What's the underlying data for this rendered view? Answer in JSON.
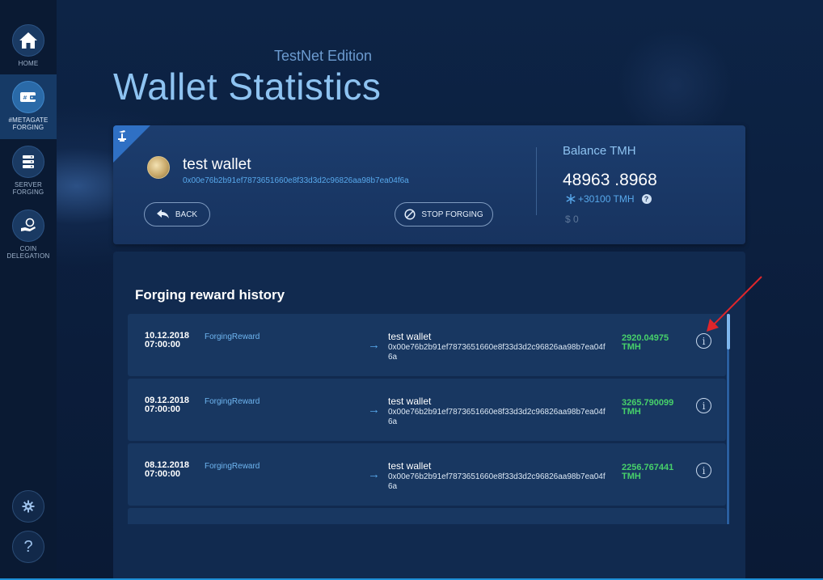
{
  "sidebar": {
    "items": [
      {
        "label": "HOME",
        "icon": "home-icon"
      },
      {
        "label": "#METAGATE FORGING",
        "icon": "wallet-icon"
      },
      {
        "label": "SERVER FORGING",
        "icon": "server-icon"
      },
      {
        "label": "COIN DELEGATION",
        "icon": "hand-coin-icon"
      }
    ],
    "settings_icon": "gear-icon",
    "help_label": "?"
  },
  "header": {
    "edition": "TestNet Edition",
    "title": "Wallet Statistics"
  },
  "wallet": {
    "name": "test wallet",
    "address": "0x00e76b2b91ef7873651660e8f33d3d2c96826aa98b7ea04f6a",
    "back_label": "BACK",
    "stop_label": "STOP FORGING",
    "balance_label": "Balance TMH",
    "balance_value": "48963 .8968",
    "delta": "+30100 TMH",
    "help": "?",
    "usd": "$ 0"
  },
  "history": {
    "title": "Forging reward history",
    "rows": [
      {
        "date": "10.12.2018",
        "time": "07:00:00",
        "type": "ForgingReward",
        "wallet": "test wallet",
        "address": "0x00e76b2b91ef7873651660e8f33d3d2c96826aa98b7ea04f6a",
        "amount": "2920.04975",
        "unit": "TMH"
      },
      {
        "date": "09.12.2018",
        "time": "07:00:00",
        "type": "ForgingReward",
        "wallet": "test wallet",
        "address": "0x00e76b2b91ef7873651660e8f33d3d2c96826aa98b7ea04f6a",
        "amount": "3265.790099",
        "unit": "TMH"
      },
      {
        "date": "08.12.2018",
        "time": "07:00:00",
        "type": "ForgingReward",
        "wallet": "test wallet",
        "address": "0x00e76b2b91ef7873651660e8f33d3d2c96826aa98b7ea04f6a",
        "amount": "2256.767441",
        "unit": "TMH"
      }
    ],
    "info_label": "i",
    "arrow": "→"
  },
  "colors": {
    "accent": "#58a9ec",
    "amount": "#47d16a",
    "annotation": "#e0262b"
  }
}
